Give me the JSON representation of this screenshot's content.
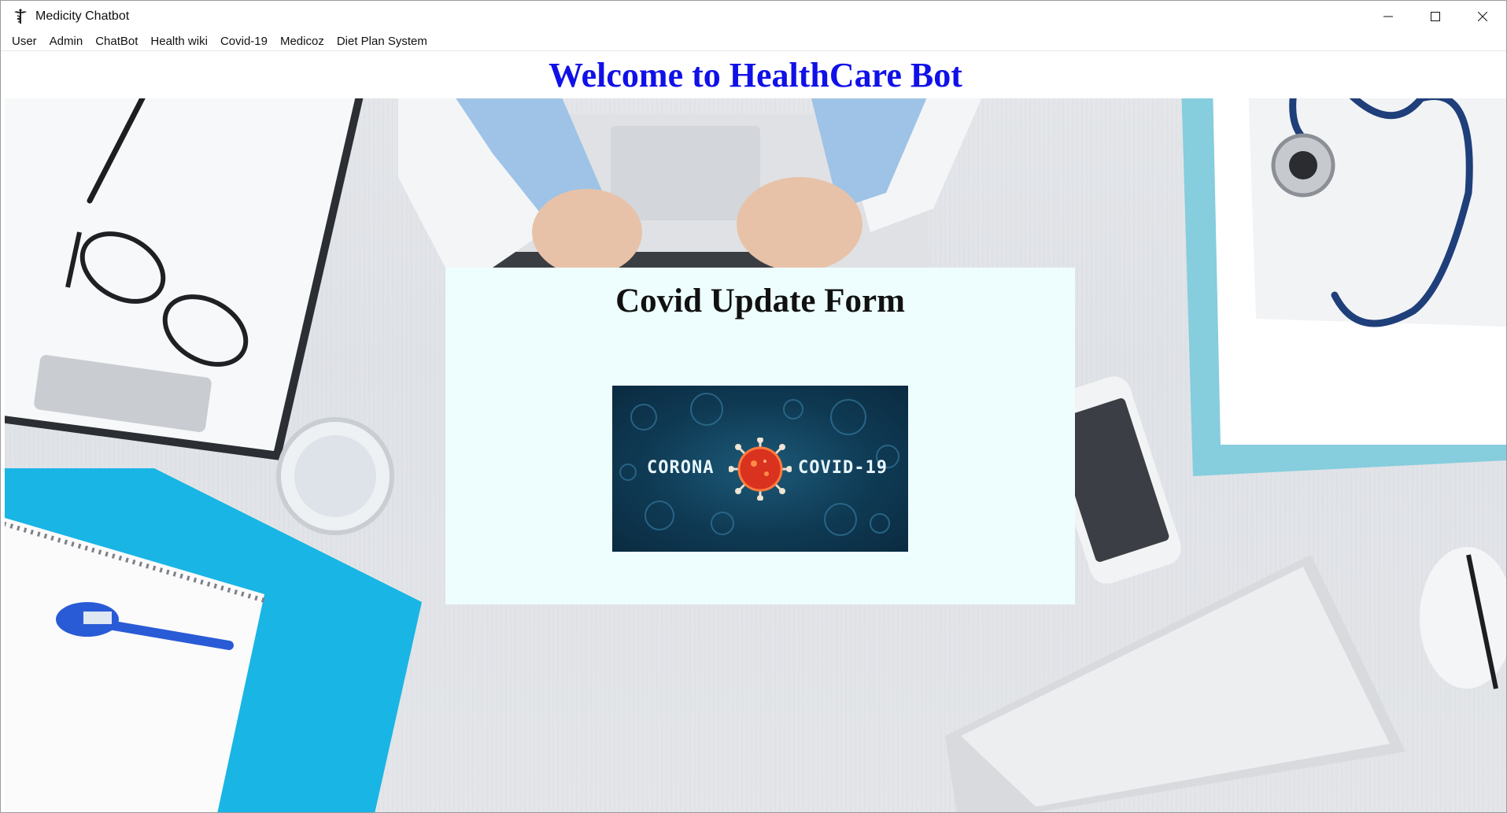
{
  "window": {
    "title": "Medicity Chatbot",
    "app_icon": "caduceus-icon",
    "controls": {
      "minimize_icon": "minimize-icon",
      "maximize_icon": "maximize-icon",
      "close_icon": "close-icon"
    }
  },
  "menubar": {
    "items": [
      {
        "label": "User"
      },
      {
        "label": "Admin"
      },
      {
        "label": "ChatBot"
      },
      {
        "label": "Health wiki"
      },
      {
        "label": "Covid-19"
      },
      {
        "label": "Medicoz"
      },
      {
        "label": "Diet Plan System"
      }
    ]
  },
  "main": {
    "welcome_heading": "Welcome to HealthCare Bot",
    "welcome_color": "#1010e8",
    "form": {
      "title": "Covid Update Form",
      "background": "#eefeff",
      "banner": {
        "left_text": "CORONA",
        "right_text": "COVID-19",
        "icon": "coronavirus-icon"
      }
    },
    "background_scene": "medical-desk-image"
  }
}
